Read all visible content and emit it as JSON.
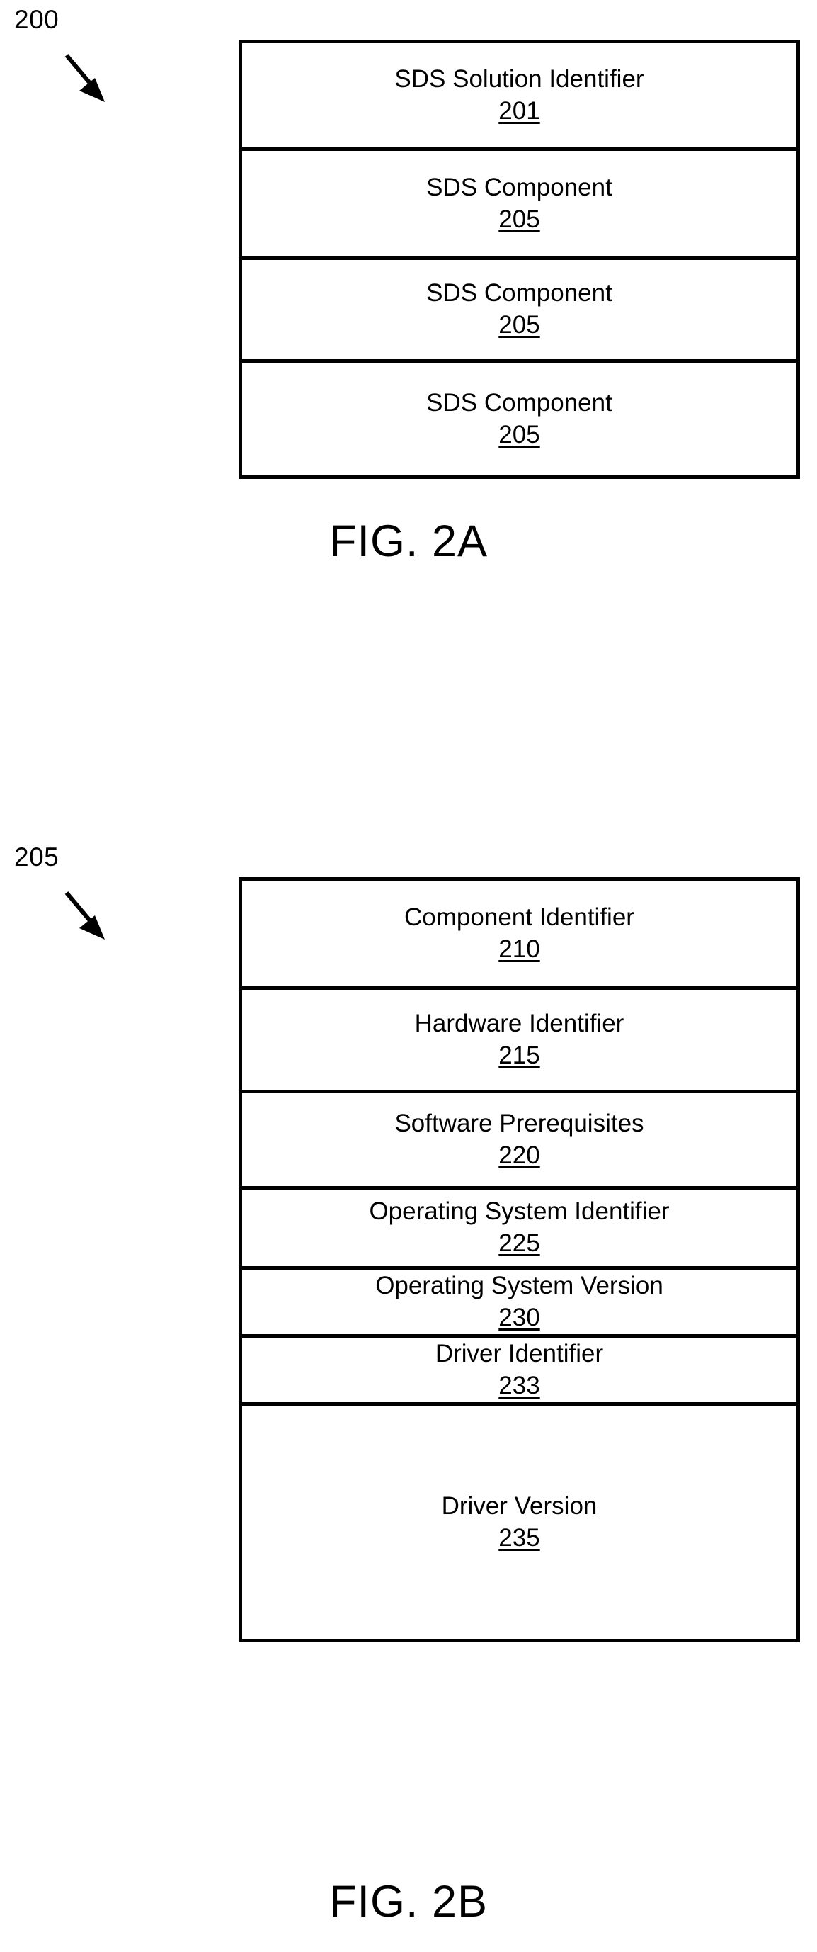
{
  "sheet": {
    "background_color": "#ffffff",
    "line_color": "#000000"
  },
  "figures": [
    {
      "caption": "FIG. 2A",
      "callout": {
        "numeral": "200",
        "arrow": "diagonal-arrow-down-right-icon"
      },
      "rows": [
        {
          "title": "SDS Solution Identifier",
          "number": "201"
        },
        {
          "title": "SDS Component",
          "number": "205"
        },
        {
          "title": "SDS Component",
          "number": "205"
        },
        {
          "title": "SDS Component",
          "number": "205"
        }
      ]
    },
    {
      "caption": "FIG. 2B",
      "callout": {
        "numeral": "205",
        "arrow": "diagonal-arrow-down-right-icon"
      },
      "rows": [
        {
          "title": "Component Identifier",
          "number": "210"
        },
        {
          "title": "Hardware Identifier",
          "number": "215"
        },
        {
          "title": "Software Prerequisites",
          "number": "220"
        },
        {
          "title": "Operating System Identifier",
          "number": "225"
        },
        {
          "title": "Operating System Version",
          "number": "230"
        },
        {
          "title": "Driver Identifier",
          "number": "233"
        },
        {
          "title": "Driver Version",
          "number": "235"
        }
      ]
    }
  ]
}
